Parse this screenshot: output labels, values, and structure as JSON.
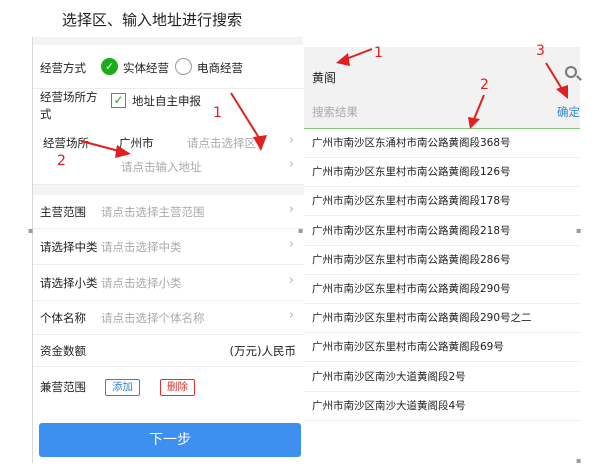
{
  "caption": "选择区、输入地址进行搜索",
  "form": {
    "business_mode": {
      "label": "经营方式",
      "options": [
        {
          "label": "实体经营",
          "selected": true
        },
        {
          "label": "电商经营",
          "selected": false
        }
      ]
    },
    "premises_mode": {
      "label": "经营场所方式",
      "checkbox_label": "地址自主申报",
      "checked": true
    },
    "premises": {
      "label": "经营场所",
      "city": "广州市",
      "district_placeholder": "请点击选择区",
      "address_placeholder": "请点击输入地址"
    },
    "main_scope": {
      "label": "主营范围",
      "placeholder": "请点击选择主营范围"
    },
    "middle_class": {
      "label": "请选择中类",
      "placeholder": "请点击选择中类"
    },
    "small_class": {
      "label": "请选择小类",
      "placeholder": "请点击选择小类"
    },
    "individual_name": {
      "label": "个体名称",
      "placeholder": "请点击选择个体名称"
    },
    "capital": {
      "label": "资金数额",
      "unit": "(万元)人民币"
    },
    "side_scope": {
      "label": "兼营范围",
      "add_label": "添加",
      "delete_label": "删除"
    },
    "next_button": "下一步"
  },
  "search": {
    "query": "黄阁",
    "results_label": "搜索结果",
    "confirm_label": "确定",
    "results": [
      "广州市南沙区东涌村市南公路黄阁段368号",
      "广州市南沙区东里村市南公路黄阁段126号",
      "广州市南沙区东里村市南公路黄阁段178号",
      "广州市南沙区东里村市南公路黄阁段218号",
      "广州市南沙区东里村市南公路黄阁段286号",
      "广州市南沙区东里村市南公路黄阁段290号",
      "广州市南沙区东里村市南公路黄阁段290号之二",
      "广州市南沙区东里村市南公路黄阁段69号",
      "广州市南沙区南沙大道黄阁段2号",
      "广州市南沙区南沙大道黄阁段4号"
    ]
  },
  "annotations": {
    "left_1": "1",
    "left_2": "2",
    "right_1": "1",
    "right_2": "2",
    "right_3": "3"
  },
  "colors": {
    "accent_blue": "#3d8ff0",
    "link_blue": "#2f86d8",
    "green": "#1aad19",
    "annotation_red": "#e02020",
    "delete_red": "#e03232"
  },
  "icons": {
    "search": "search-icon",
    "check": "check-icon",
    "chevron": "chevron-right-icon"
  }
}
